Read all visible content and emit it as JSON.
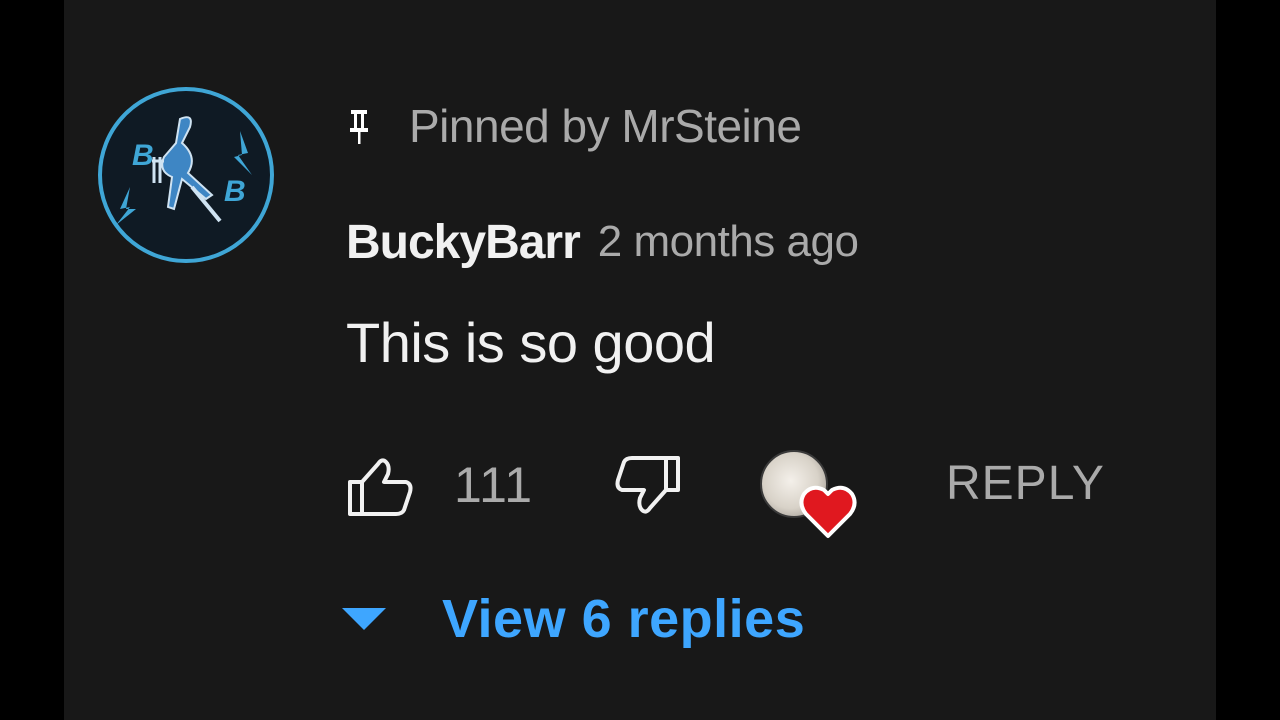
{
  "comment": {
    "avatar": {
      "icon": "channel-logo-icon",
      "letters": [
        "B",
        "B"
      ],
      "ring_color": "#3fa6d6"
    },
    "pinned": {
      "icon": "pin-icon",
      "text": "Pinned by MrSteine"
    },
    "author": "BuckyBarr",
    "timestamp": "2 months ago",
    "text": "This is so good",
    "actions": {
      "like_icon": "thumbs-up-icon",
      "like_count": "111",
      "dislike_icon": "thumbs-down-icon",
      "creator_heart_icon": "heart-icon",
      "heart_color": "#e0181f",
      "reply_label": "REPLY"
    },
    "replies": {
      "icon": "caret-down-icon",
      "label": "View 6 replies",
      "color": "#3ea6ff"
    }
  }
}
